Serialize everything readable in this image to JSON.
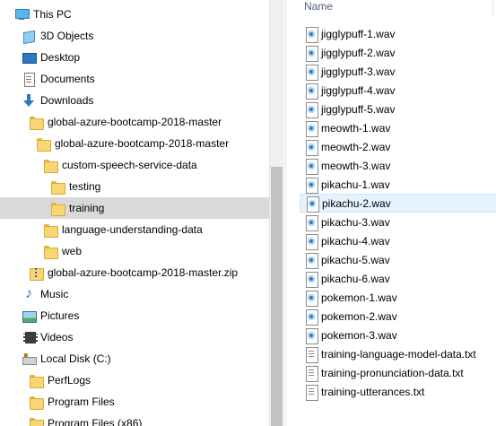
{
  "navigation_pane": {
    "items": [
      {
        "label": "This PC",
        "icon": "pc-icon",
        "selected": false
      },
      {
        "label": "3D Objects",
        "icon": "cube-icon",
        "selected": false
      },
      {
        "label": "Desktop",
        "icon": "desktop-icon",
        "selected": false
      },
      {
        "label": "Documents",
        "icon": "documents-icon",
        "selected": false
      },
      {
        "label": "Downloads",
        "icon": "download-icon",
        "selected": false
      },
      {
        "label": "global-azure-bootcamp-2018-master",
        "icon": "folder-icon",
        "selected": false
      },
      {
        "label": "global-azure-bootcamp-2018-master",
        "icon": "folder-icon",
        "selected": false
      },
      {
        "label": "custom-speech-service-data",
        "icon": "folder-icon",
        "selected": false
      },
      {
        "label": "testing",
        "icon": "folder-icon",
        "selected": false
      },
      {
        "label": "training",
        "icon": "folder-icon",
        "selected": true
      },
      {
        "label": "language-understanding-data",
        "icon": "folder-icon",
        "selected": false
      },
      {
        "label": "web",
        "icon": "folder-icon",
        "selected": false
      },
      {
        "label": "global-azure-bootcamp-2018-master.zip",
        "icon": "zip-icon",
        "selected": false
      },
      {
        "label": "Music",
        "icon": "music-icon",
        "selected": false
      },
      {
        "label": "Pictures",
        "icon": "pictures-icon",
        "selected": false
      },
      {
        "label": "Videos",
        "icon": "videos-icon",
        "selected": false
      },
      {
        "label": "Local Disk (C:)",
        "icon": "disk-icon",
        "selected": false
      },
      {
        "label": "PerfLogs",
        "icon": "folder-icon",
        "selected": false
      },
      {
        "label": "Program Files",
        "icon": "folder-icon",
        "selected": false
      },
      {
        "label": "Program Files (x86)",
        "icon": "folder-icon",
        "selected": false
      }
    ]
  },
  "file_list": {
    "column_header": "Name",
    "files": [
      {
        "name": "jigglypuff-1.wav",
        "icon": "wav-icon"
      },
      {
        "name": "jigglypuff-2.wav",
        "icon": "wav-icon"
      },
      {
        "name": "jigglypuff-3.wav",
        "icon": "wav-icon"
      },
      {
        "name": "jigglypuff-4.wav",
        "icon": "wav-icon"
      },
      {
        "name": "jigglypuff-5.wav",
        "icon": "wav-icon"
      },
      {
        "name": "meowth-1.wav",
        "icon": "wav-icon"
      },
      {
        "name": "meowth-2.wav",
        "icon": "wav-icon"
      },
      {
        "name": "meowth-3.wav",
        "icon": "wav-icon"
      },
      {
        "name": "pikachu-1.wav",
        "icon": "wav-icon"
      },
      {
        "name": "pikachu-2.wav",
        "icon": "wav-icon",
        "hovered": true
      },
      {
        "name": "pikachu-3.wav",
        "icon": "wav-icon"
      },
      {
        "name": "pikachu-4.wav",
        "icon": "wav-icon"
      },
      {
        "name": "pikachu-5.wav",
        "icon": "wav-icon"
      },
      {
        "name": "pikachu-6.wav",
        "icon": "wav-icon"
      },
      {
        "name": "pokemon-1.wav",
        "icon": "wav-icon"
      },
      {
        "name": "pokemon-2.wav",
        "icon": "wav-icon"
      },
      {
        "name": "pokemon-3.wav",
        "icon": "wav-icon"
      },
      {
        "name": "training-language-model-data.txt",
        "icon": "txt-icon"
      },
      {
        "name": "training-pronunciation-data.txt",
        "icon": "txt-icon"
      },
      {
        "name": "training-utterances.txt",
        "icon": "txt-icon"
      }
    ]
  },
  "colors": {
    "selected_background": "#d9d9d9",
    "hover_background": "#e5f3ff",
    "column_header_text": "#4c607a"
  }
}
